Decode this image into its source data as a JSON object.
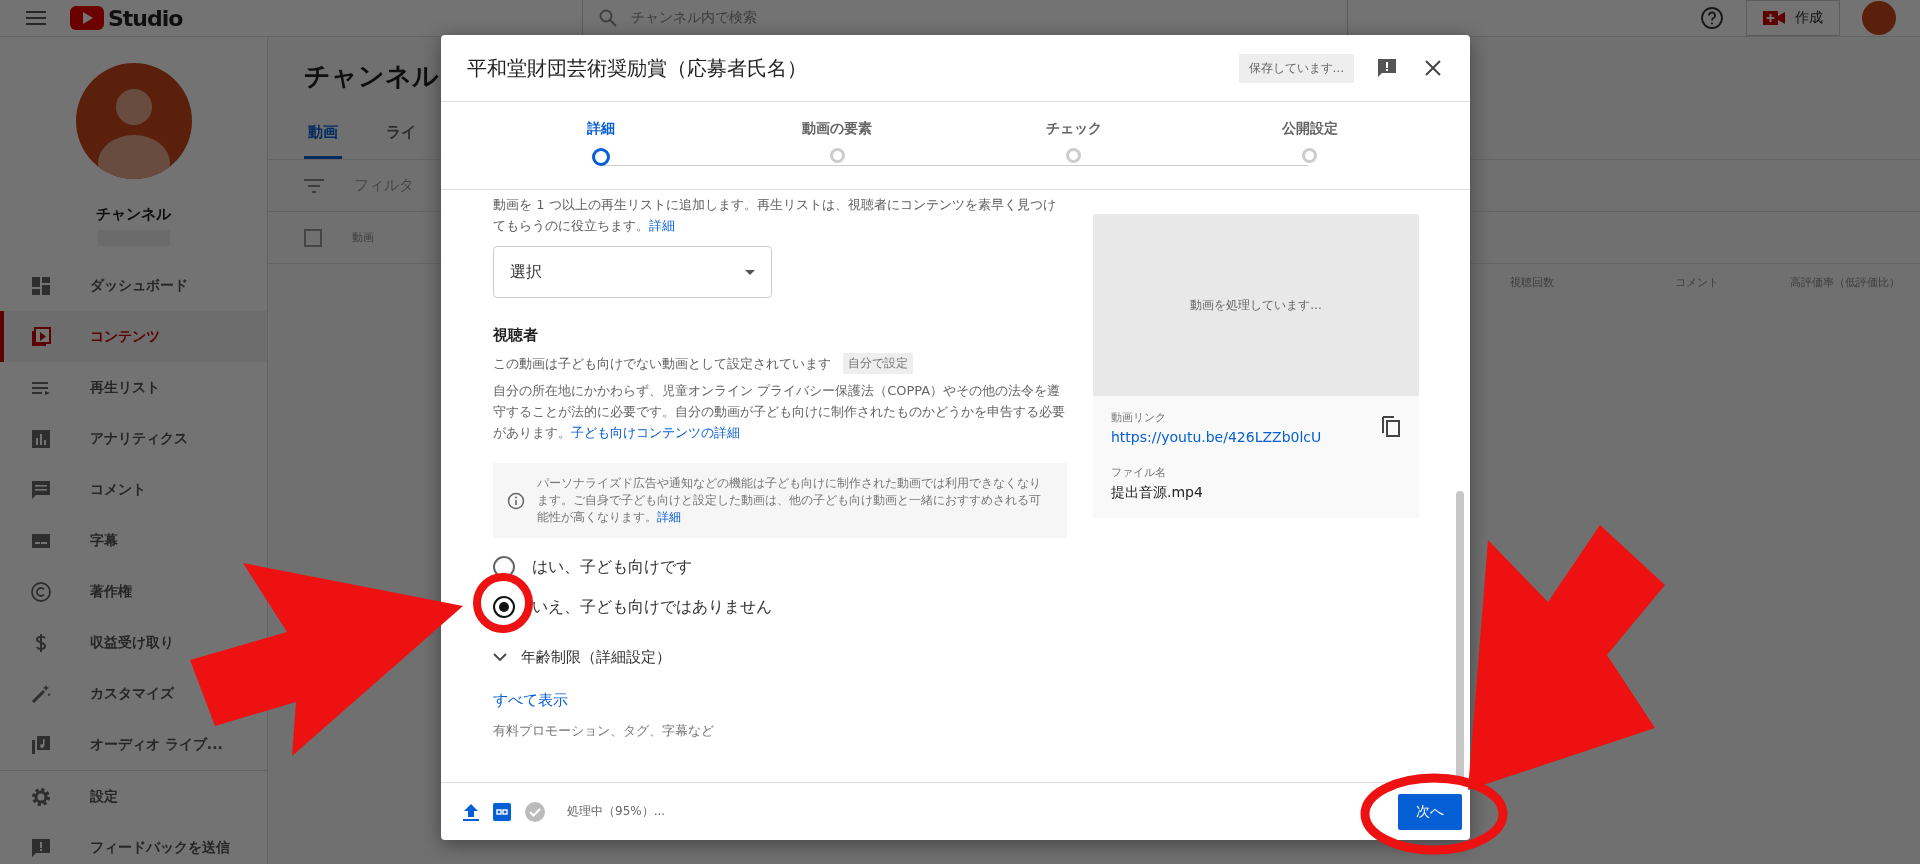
{
  "header": {
    "logo_text": "Studio",
    "search": {
      "placeholder": "チャンネル内で検索"
    },
    "create_button": "作成"
  },
  "sidebar": {
    "channel_name": "チャンネル",
    "items": [
      {
        "label": "ダッシュボード",
        "kind": "dashboard",
        "selected": false
      },
      {
        "label": "コンテンツ",
        "kind": "content",
        "selected": true
      },
      {
        "label": "再生リスト",
        "kind": "playlist",
        "selected": false
      },
      {
        "label": "アナリティクス",
        "kind": "analytics",
        "selected": false
      },
      {
        "label": "コメント",
        "kind": "comment",
        "selected": false
      },
      {
        "label": "字幕",
        "kind": "subtitles",
        "selected": false
      },
      {
        "label": "著作権",
        "kind": "copyright",
        "selected": false
      },
      {
        "label": "収益受け取り",
        "kind": "dollar",
        "selected": false
      },
      {
        "label": "カスタマイズ",
        "kind": "wand",
        "selected": false
      },
      {
        "label": "オーディオ ライブ...",
        "kind": "music",
        "selected": false
      }
    ],
    "footer_items": [
      {
        "label": "設定",
        "kind": "gear"
      },
      {
        "label": "フィードバックを送信",
        "kind": "feedback"
      }
    ]
  },
  "main": {
    "title": "チャンネル",
    "tabs": [
      {
        "label": "動画",
        "selected": true
      },
      {
        "label": "ライ",
        "selected": false
      }
    ],
    "filter": "フィルタ",
    "select_all": {
      "checked": false
    },
    "columns": [
      "動画",
      "視聴回数",
      "コメント",
      "高評価率（低評価比）"
    ]
  },
  "dialog": {
    "title": "平和堂財団芸術奨励賞（応募者氏名）",
    "saving": "保存しています...",
    "steps": [
      {
        "label": "詳細",
        "selected": true
      },
      {
        "label": "動画の要素",
        "selected": false
      },
      {
        "label": "チェック",
        "selected": false
      },
      {
        "label": "公開設定",
        "selected": false
      }
    ],
    "playlist_text": "動画を 1 つ以上の再生リストに追加します。再生リストは、視聴者にコンテンツを素早く見つけてもらうのに役立ちます。",
    "playlist_link": "詳細",
    "playlist_select": "選択",
    "audience_heading": "視聴者",
    "audience_status": "この動画は子ども向けでない動画として設定されています",
    "audience_badge": "自分で設定",
    "audience_text": "自分の所在地にかかわらず、児童オンライン プライバシー保護法（COPPA）やその他の法令を遵守することが法的に必要です。自分の動画が子ども向けに制作されたものかどうかを申告する必要があります。",
    "audience_link": "子ども向けコンテンツの詳細",
    "info_text": "パーソナライズド広告や通知などの機能は子ども向けに制作された動画では利用できなくなります。ご自身で子ども向けと設定した動画は、他の子ども向け動画と一緒におすすめされる可能性が高くなります。",
    "info_link": "詳細",
    "options": [
      {
        "label": "はい、子ども向けです",
        "selected": false
      },
      {
        "label": "いえ、子ども向けではありません",
        "selected": true
      }
    ],
    "age_restriction": {
      "label": "年齢制限（詳細設定）",
      "expanded": false
    },
    "show_all": "すべて表示",
    "show_all_hint": "有料プロモーション、タグ、字幕など",
    "preview": {
      "processing": "動画を処理しています...",
      "link_label": "動画リンク",
      "link": "https://youtu.be/426LZZb0lcU",
      "file_label": "ファイル名",
      "file_name": "提出音源.mp4"
    },
    "footer": {
      "status": "処理中（95%）...",
      "next_button": "次へ"
    }
  }
}
